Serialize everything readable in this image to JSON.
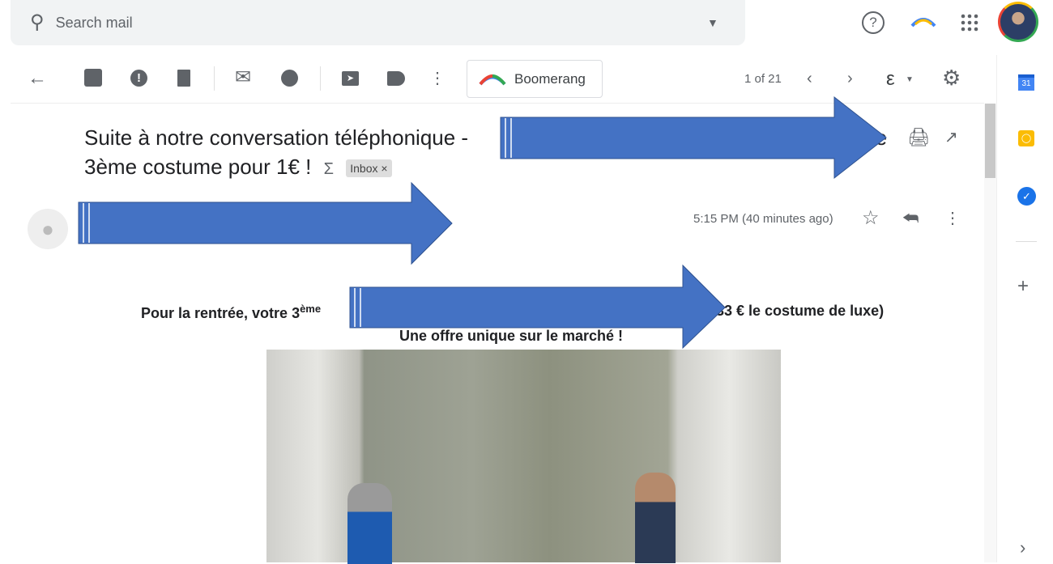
{
  "search": {
    "placeholder": "Search mail"
  },
  "toolbar": {
    "boomerang_label": "Boomerang",
    "pagination": "1 of 21",
    "input_tool": "ε"
  },
  "email": {
    "subject_line1": "Suite à notre conversation téléphonique - ",
    "subject_hidden_tail": "re",
    "subject_line2": "3ème costume pour 1€ !",
    "label": "Inbox",
    "label_remove": "×",
    "time": "5:15 PM (40 minutes ago)",
    "body_line1_start": "Pour la rentrée, votre 3",
    "body_sup": "ème",
    "body_line1_end": "33 € le costume de luxe)",
    "body_line2": "Une offre unique sur le marché !"
  },
  "side_apps": [
    {
      "name": "calendar",
      "text": "31"
    },
    {
      "name": "keep"
    },
    {
      "name": "tasks"
    }
  ],
  "colors": {
    "redaction": "#4472c4",
    "accent": "#1a73e8"
  }
}
